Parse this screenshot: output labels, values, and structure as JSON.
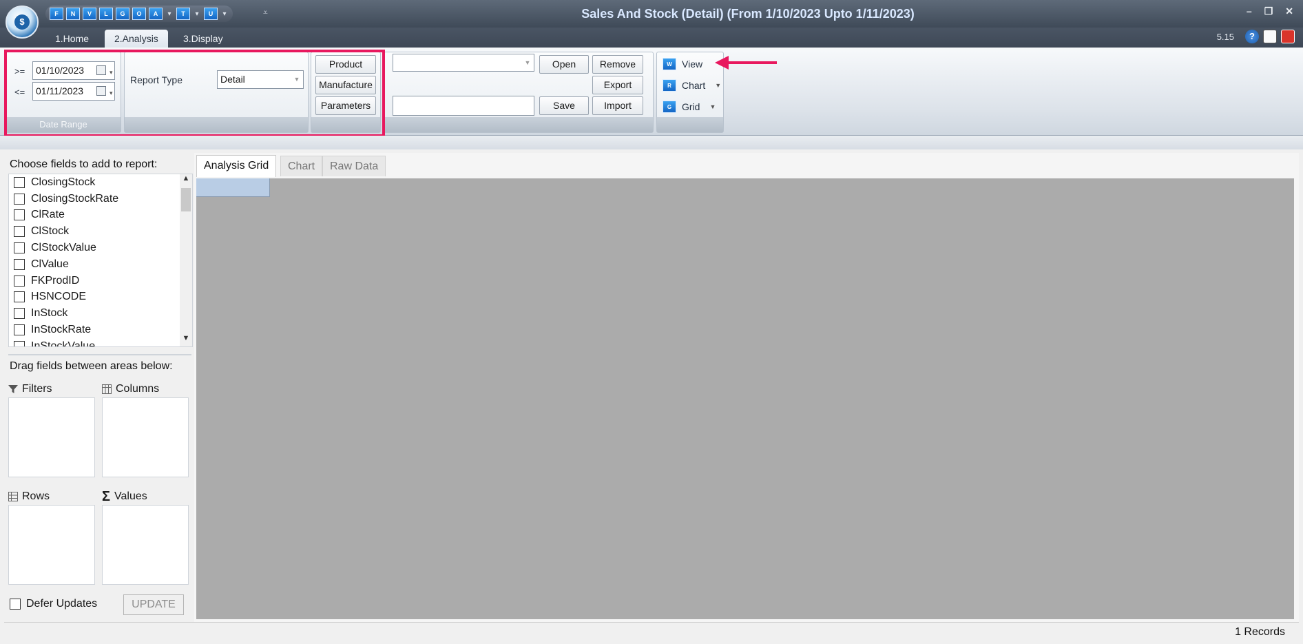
{
  "window": {
    "title": "Sales And Stock (Detail)  (From 1/10/2023 Upto 1/11/2023)",
    "logo_letter": "$",
    "version": "5.15",
    "controls": [
      "–",
      "❐",
      "✕"
    ]
  },
  "quick_access": [
    {
      "label": "F"
    },
    {
      "label": "N"
    },
    {
      "label": "V"
    },
    {
      "label": "L"
    },
    {
      "label": "G"
    },
    {
      "label": "O"
    },
    {
      "label": "A",
      "dropdown": true
    },
    {
      "label": "T",
      "dropdown": true
    },
    {
      "label": "U",
      "dropdown": true
    }
  ],
  "ribbon_tabs": [
    {
      "label": "1.Home",
      "active": false
    },
    {
      "label": "2.Analysis",
      "active": true
    },
    {
      "label": "3.Display",
      "active": false
    }
  ],
  "date_range": {
    "ge_label": ">=",
    "le_label": "<=",
    "from": "01/10/2023",
    "to": "01/11/2023",
    "group_label": "Date Range"
  },
  "report_type": {
    "label": "Report Type",
    "value": "Detail"
  },
  "filter_buttons": {
    "product": "Product",
    "manufacture": "Manufacture",
    "parameters": "Parameters"
  },
  "layout_controls": {
    "combo_value": "",
    "name_value": "",
    "open": "Open",
    "remove": "Remove",
    "export": "Export",
    "save": "Save",
    "import": "Import"
  },
  "view_group": {
    "view": "View",
    "chart": "Chart",
    "grid": "Grid"
  },
  "field_panel": {
    "title": "Choose fields to add to report:",
    "fields": [
      "ClosingStock",
      "ClosingStockRate",
      "ClRate",
      "ClStock",
      "ClStockValue",
      "ClValue",
      "FKProdID",
      "HSNCODE",
      "InStock",
      "InStockRate",
      "InStockValue"
    ],
    "drag_title": "Drag fields between areas below:",
    "filters": "Filters",
    "columns": "Columns",
    "rows": "Rows",
    "values": "Values",
    "defer_updates": "Defer Updates",
    "update": "UPDATE"
  },
  "content_tabs": [
    {
      "label": "Analysis Grid",
      "active": true
    },
    {
      "label": "Chart",
      "active": false
    },
    {
      "label": "Raw Data",
      "active": false
    }
  ],
  "status": {
    "records": "1 Records"
  },
  "colors": {
    "highlight": "#e8185e",
    "accent_blue": "#1466c5",
    "grid_bg": "#ababab"
  }
}
